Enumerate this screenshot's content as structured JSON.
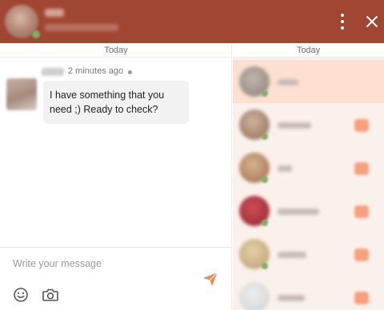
{
  "header": {
    "contact_name": "",
    "status": ""
  },
  "chat": {
    "date_label": "Today",
    "messages": [
      {
        "time": "2 minutes ago",
        "text_line1": "I have something that you",
        "text_line2": "need ;) Ready to check?"
      }
    ],
    "composer": {
      "placeholder": "Write your message"
    }
  },
  "contacts": {
    "date_label": "Today"
  },
  "icons": {
    "menu": "more-vertical-icon",
    "close": "close-icon",
    "send": "send-icon",
    "emoji": "smiley-icon",
    "camera": "camera-icon"
  },
  "colors": {
    "header": "#a14632",
    "accent": "#f08a55",
    "active_contact": "#fde0d2",
    "list_background": "#fbf1ec"
  }
}
